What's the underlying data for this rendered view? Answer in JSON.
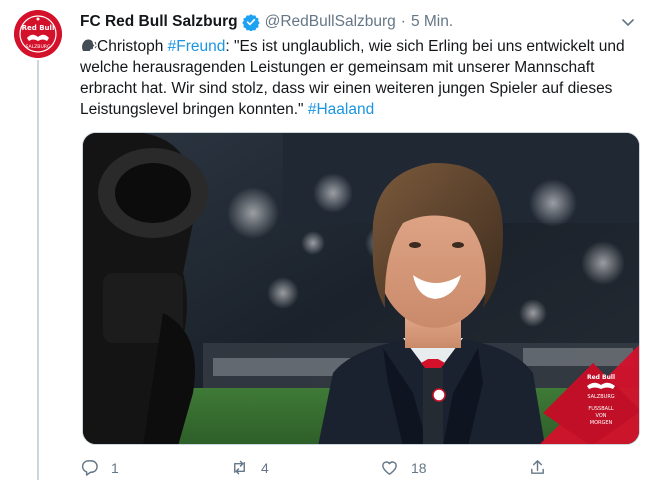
{
  "tweet": {
    "author_name": "FC Red Bull Salzburg",
    "handle": "@RedBullSalzburg",
    "separator": "·",
    "time": "5 Min.",
    "text_1": "Christoph ",
    "hashtag_1": "#Freund",
    "text_2": ": \"Es ist unglaublich, wie sich Erling bei uns entwickelt und welche herausragenden Leistungen er gemeinsam mit unserer Mannschaft erbracht hat. Wir sind stolz, dass wir einen weiteren jungen Spieler auf dieses Leistungslevel bringen konnten.\" ",
    "hashtag_2": "#Haaland"
  },
  "actions": {
    "reply_count": "1",
    "retweet_count": "4",
    "like_count": "18"
  },
  "media_logo": {
    "brand": "Red Bull",
    "club": "SALZBURG",
    "slogan_1": "FUSSBALL",
    "slogan_2": "VON",
    "slogan_3": "MORGEN"
  },
  "colors": {
    "brand_red": "#d4112b",
    "link_blue": "#1b95e0",
    "verified_blue": "#1da1f2",
    "muted_gray": "#657786"
  }
}
